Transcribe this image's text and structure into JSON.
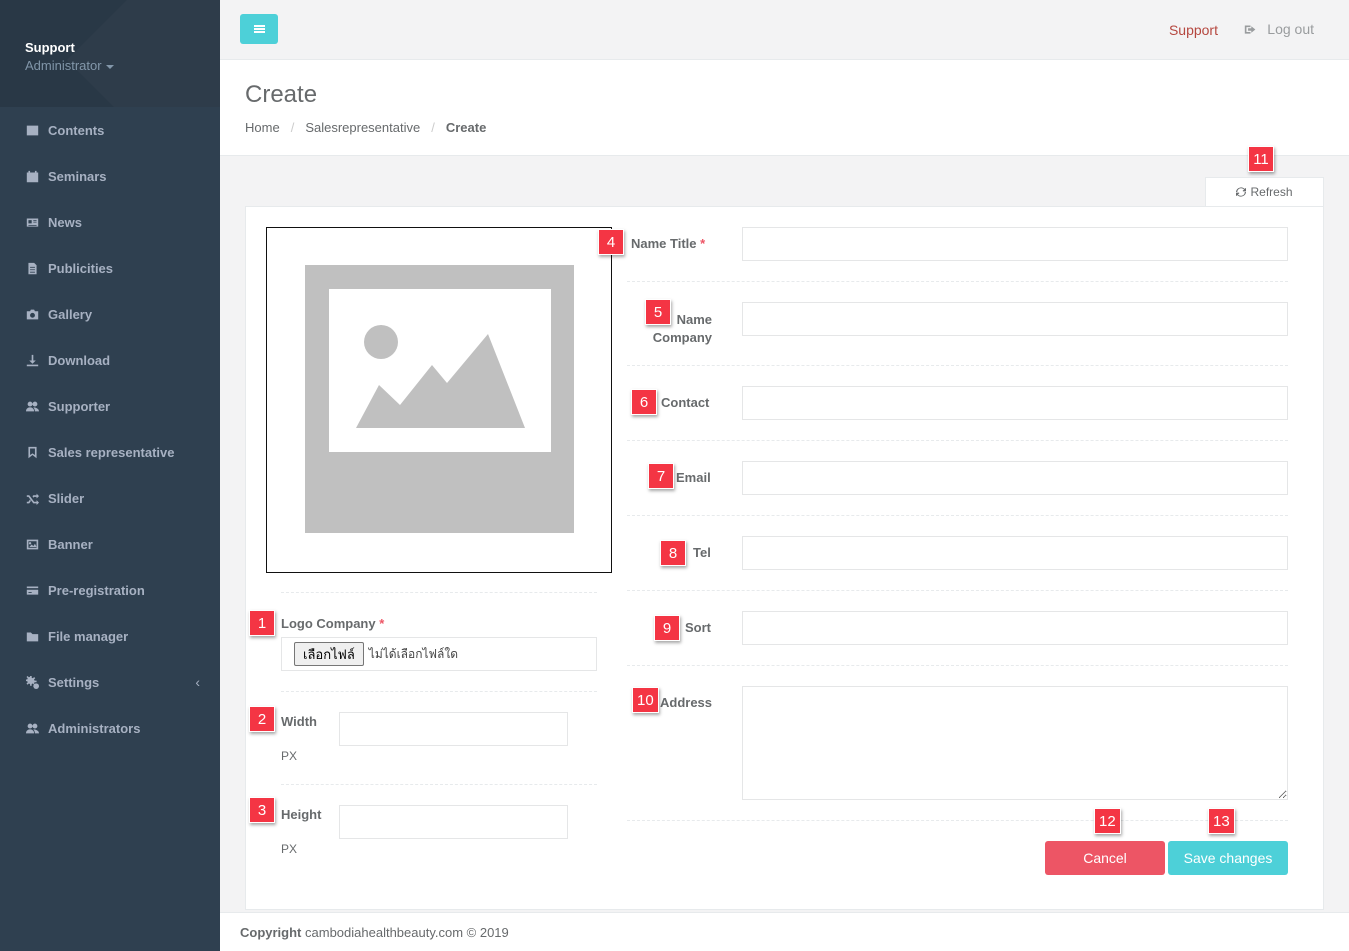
{
  "sidebar": {
    "profile": {
      "name": "Support",
      "role": "Administrator"
    },
    "items": [
      {
        "label": "Contents",
        "icon": "list-alt-icon"
      },
      {
        "label": "Seminars",
        "icon": "calendar-icon"
      },
      {
        "label": "News",
        "icon": "newspaper-icon"
      },
      {
        "label": "Publicities",
        "icon": "file-icon"
      },
      {
        "label": "Gallery",
        "icon": "camera-icon"
      },
      {
        "label": "Download",
        "icon": "download-icon"
      },
      {
        "label": "Supporter",
        "icon": "users-icon"
      },
      {
        "label": "Sales representative",
        "icon": "bookmark-icon"
      },
      {
        "label": "Slider",
        "icon": "random-icon"
      },
      {
        "label": "Banner",
        "icon": "image-icon"
      },
      {
        "label": "Pre-registration",
        "icon": "credit-card-icon"
      },
      {
        "label": "File manager",
        "icon": "folder-icon"
      },
      {
        "label": "Settings",
        "icon": "cogs-icon"
      },
      {
        "label": "Administrators",
        "icon": "users-icon"
      }
    ]
  },
  "topbar": {
    "support_label": "Support",
    "logout_label": "Log out"
  },
  "heading": {
    "title": "Create",
    "breadcrumb": [
      "Home",
      "Salesrepresentative",
      "Create"
    ]
  },
  "refresh_label": "Refresh",
  "form": {
    "logo_label": "Logo Company",
    "file_button": "เลือกไฟล์",
    "file_status": "ไม่ได้เลือกไฟล์ใด",
    "width_label": "Width",
    "height_label": "Height",
    "unit": "PX",
    "name_title_label": "Name Title",
    "name_company_label": "Name Company",
    "contact_label": "Contact",
    "email_label": "Email",
    "tel_label": "Tel",
    "sort_label": "Sort",
    "address_label": "Address",
    "required_mark": "*",
    "cancel_label": "Cancel",
    "save_label": "Save changes"
  },
  "callouts": [
    "1",
    "2",
    "3",
    "4",
    "5",
    "6",
    "7",
    "8",
    "9",
    "10",
    "11",
    "12",
    "13"
  ],
  "footer": {
    "copyright_label": "Copyright",
    "text": "cambodiahealthbeauty.com © 2019"
  },
  "colors": {
    "sidebar": "#2f4050",
    "accent": "#4dd0d8",
    "danger": "#ed5565",
    "callout": "#f43544"
  }
}
